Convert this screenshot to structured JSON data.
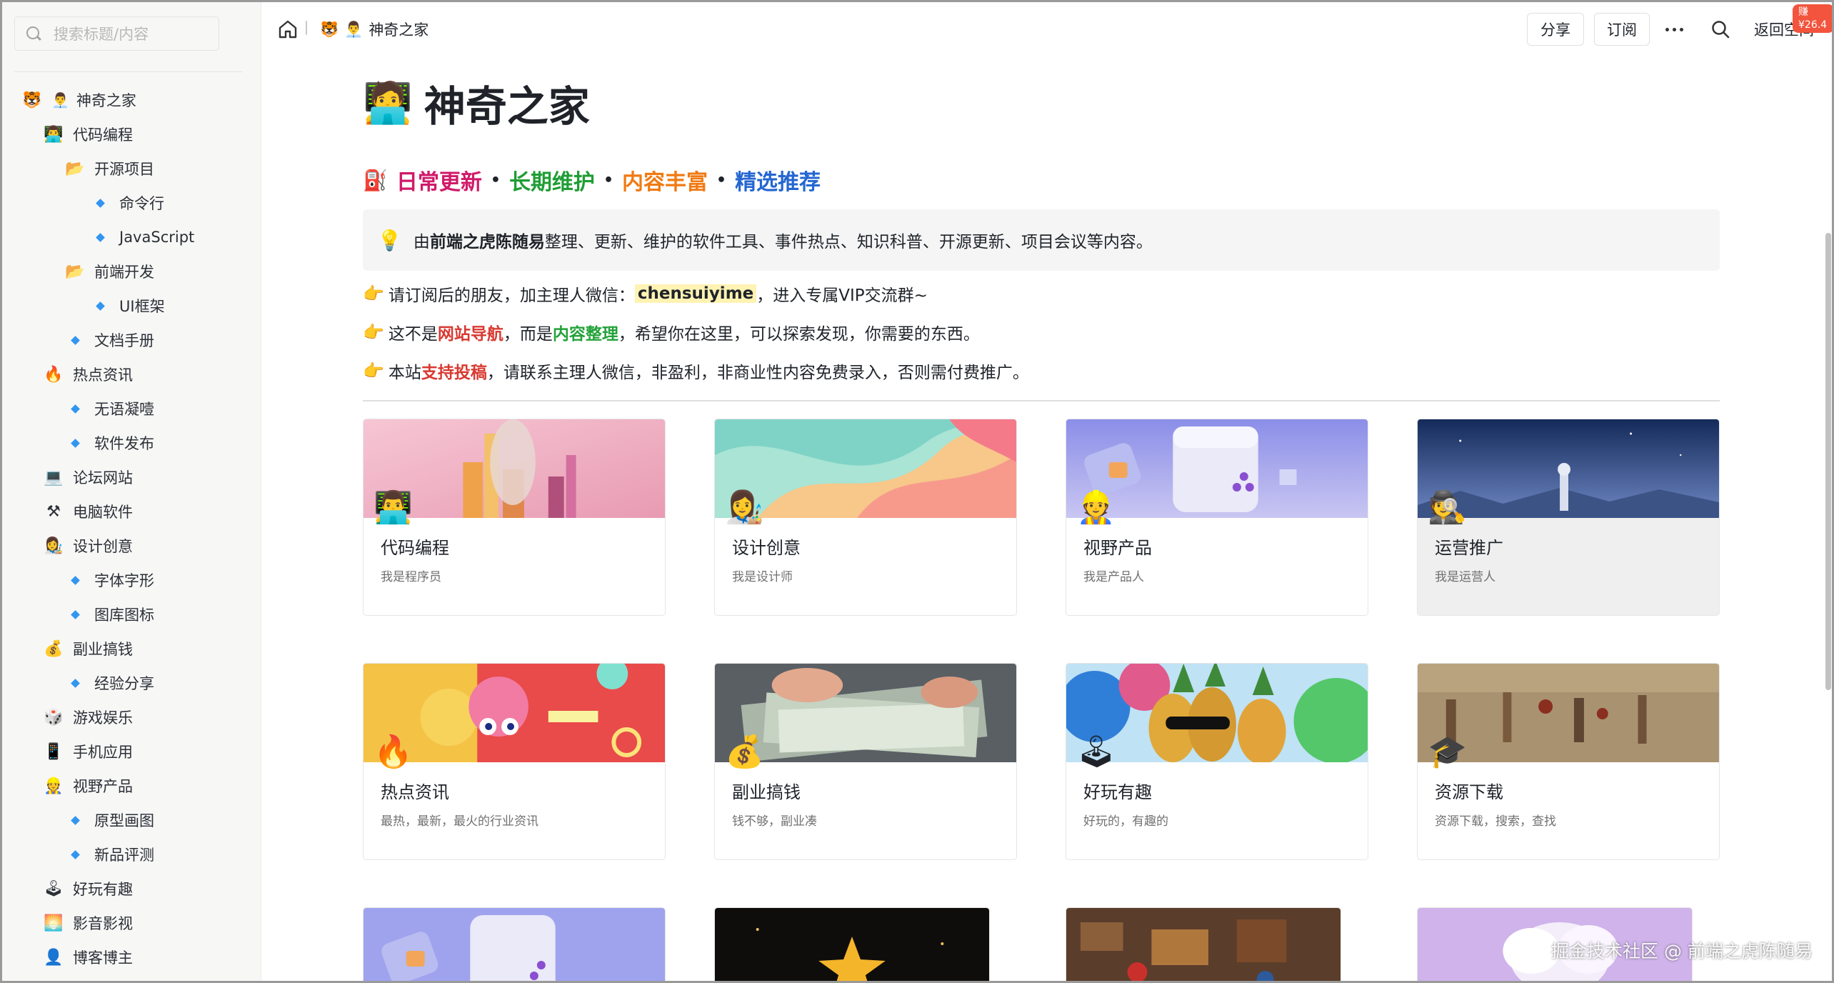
{
  "sidebar": {
    "search_placeholder": "搜索标题/内容",
    "items": [
      {
        "icon": "🐯",
        "icon2": "👨‍💼",
        "label": "神奇之家",
        "level": 0
      },
      {
        "icon": "👨‍💻",
        "label": "代码编程",
        "level": 1
      },
      {
        "icon": "📂",
        "label": "开源项目",
        "level": 2
      },
      {
        "icon": "dot",
        "label": "命令行",
        "level": 3
      },
      {
        "icon": "dot",
        "label": "JavaScript",
        "level": 3
      },
      {
        "icon": "📂",
        "label": "前端开发",
        "level": 2
      },
      {
        "icon": "dot",
        "label": "UI框架",
        "level": 3
      },
      {
        "icon": "dot",
        "label": "文档手册",
        "level": 2
      },
      {
        "icon": "🔥",
        "label": "热点资讯",
        "level": 1
      },
      {
        "icon": "dot",
        "label": "无语凝噎",
        "level": 2
      },
      {
        "icon": "dot",
        "label": "软件发布",
        "level": 2
      },
      {
        "icon": "💻",
        "label": "论坛网站",
        "level": 1
      },
      {
        "icon": "⚒",
        "label": "电脑软件",
        "level": 1
      },
      {
        "icon": "👩‍🎨",
        "label": "设计创意",
        "level": 1
      },
      {
        "icon": "dot",
        "label": "字体字形",
        "level": 2
      },
      {
        "icon": "dot",
        "label": "图库图标",
        "level": 2
      },
      {
        "icon": "💰",
        "label": "副业搞钱",
        "level": 1
      },
      {
        "icon": "dot",
        "label": "经验分享",
        "level": 2
      },
      {
        "icon": "🎲",
        "label": "游戏娱乐",
        "level": 1
      },
      {
        "icon": "📱",
        "label": "手机应用",
        "level": 1
      },
      {
        "icon": "👷",
        "label": "视野产品",
        "level": 1
      },
      {
        "icon": "dot",
        "label": "原型画图",
        "level": 2
      },
      {
        "icon": "dot",
        "label": "新品评测",
        "level": 2
      },
      {
        "icon": "🕹",
        "label": "好玩有趣",
        "level": 1
      },
      {
        "icon": "🌅",
        "label": "影音影视",
        "level": 1
      },
      {
        "icon": "👤",
        "label": "博客博主",
        "level": 1
      }
    ]
  },
  "topbar": {
    "crumb_icon1": "🐯",
    "crumb_icon2": "👨‍💼",
    "crumb_label": "神奇之家",
    "share_label": "分享",
    "share_badge": "赚¥26.4",
    "subscribe_label": "订阅",
    "back_label": "返回空间"
  },
  "page": {
    "title_icon": "🧑‍💻",
    "title": "神奇之家",
    "tags_icon": "⛽",
    "tags": [
      {
        "text": "日常更新",
        "color": "#d11a6a"
      },
      {
        "text": "长期维护",
        "color": "#1f9d35"
      },
      {
        "text": "内容丰富",
        "color": "#f07a13"
      },
      {
        "text": "精选推荐",
        "color": "#2466d1"
      }
    ],
    "tag_sep": "•",
    "callout": {
      "icon": "💡",
      "pre": "由",
      "bold": "前端之虎陈随易",
      "post": "整理、更新、维护的软件工具、事件热点、知识科普、开源更新、项目会议等内容。"
    },
    "lines": [
      {
        "icon": "👉",
        "a": "请订阅后的朋友，加主理人微信：",
        "b": "chensuiyime",
        "c": "，进入专属VIP交流群~"
      },
      {
        "icon": "👉",
        "a": "这不是",
        "b": "网站导航",
        "c": "，而是",
        "d": "内容整理",
        "e": "，希望你在这里，可以探索发现，你需要的东西。"
      },
      {
        "icon": "👉",
        "a": "本站",
        "b": "支持投稿",
        "c": "，请联系主理人微信，非盈利，非商业性内容免费录入，否则需付费推广。"
      }
    ]
  },
  "cards": [
    {
      "emoji": "👨‍💻",
      "title": "代码编程",
      "subtitle": "我是程序员"
    },
    {
      "emoji": "👩‍🎨",
      "title": "设计创意",
      "subtitle": "我是设计师"
    },
    {
      "emoji": "👷",
      "title": "视野产品",
      "subtitle": "我是产品人"
    },
    {
      "emoji": "🕵",
      "title": "运营推广",
      "subtitle": "我是运营人"
    },
    {
      "emoji": "🔥",
      "title": "热点资讯",
      "subtitle": "最热，最新，最火的行业资讯"
    },
    {
      "emoji": "💰",
      "title": "副业搞钱",
      "subtitle": "钱不够，副业凑"
    },
    {
      "emoji": "🕹",
      "title": "好玩有趣",
      "subtitle": "好玩的，有趣的"
    },
    {
      "emoji": "🎓",
      "title": "资源下载",
      "subtitle": "资源下载，搜索，查找"
    }
  ],
  "watermark": "掘金技术社区 @ 前端之虎陈随易"
}
